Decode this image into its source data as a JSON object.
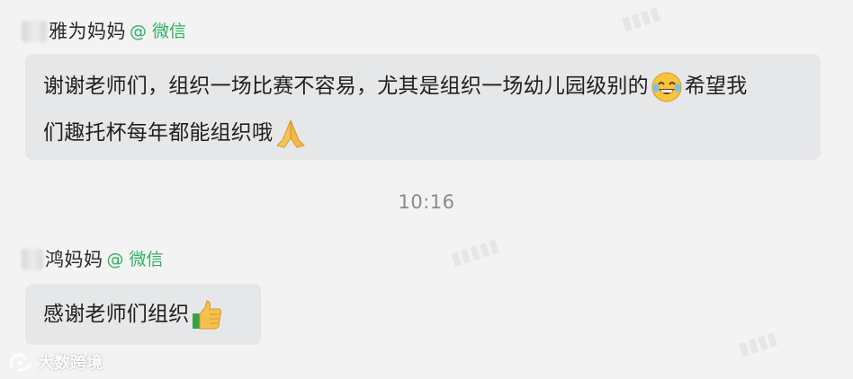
{
  "messages": [
    {
      "sender": "雅为妈妈",
      "source": "@ 微信",
      "line1": "谢谢老师们，组织一场比赛不容易，尤其是组织一场幼儿园级别的",
      "line1_after_emoji": "希望我",
      "line2": "们趣托杯每年都能组织哦",
      "emoji_1": "laughing-tears-icon",
      "emoji_2": "praying-hands-icon"
    },
    {
      "sender": "鸿妈妈",
      "source": "@ 微信",
      "line1": "感谢老师们组织",
      "emoji_1": "thumbs-up-icon"
    }
  ],
  "timestamp": "10:16",
  "watermark": "大数跨境",
  "colors": {
    "background": "#f3f3f3",
    "bubble": "#e6e7e8",
    "wechat_green": "#2db25f",
    "timestamp": "#8b8b8b"
  }
}
